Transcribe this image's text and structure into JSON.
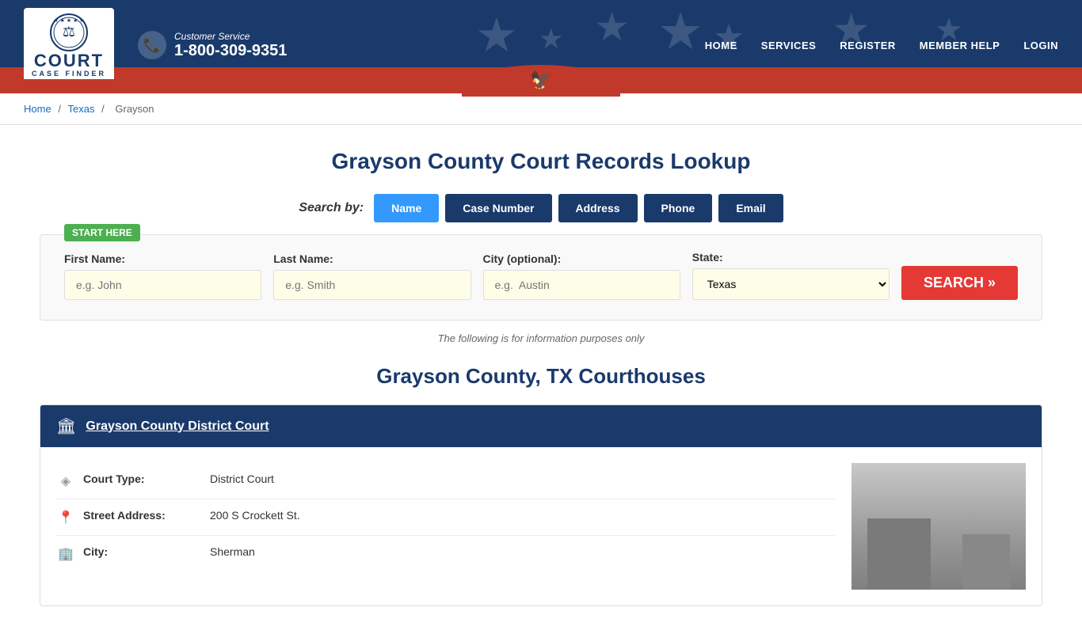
{
  "header": {
    "logo": {
      "main_text": "COURT",
      "sub_text": "CASE FINDER",
      "emblem_symbol": "⚖"
    },
    "phone": {
      "label": "Customer Service",
      "number": "1-800-309-9351"
    },
    "nav": [
      {
        "label": "HOME",
        "id": "nav-home"
      },
      {
        "label": "SERVICES",
        "id": "nav-services"
      },
      {
        "label": "REGISTER",
        "id": "nav-register"
      },
      {
        "label": "MEMBER HELP",
        "id": "nav-member-help"
      },
      {
        "label": "LOGIN",
        "id": "nav-login"
      }
    ]
  },
  "breadcrumb": {
    "home": "Home",
    "state": "Texas",
    "county": "Grayson"
  },
  "main": {
    "page_title": "Grayson County Court Records Lookup",
    "search_by_label": "Search by:",
    "tabs": [
      {
        "label": "Name",
        "active": true
      },
      {
        "label": "Case Number",
        "active": false
      },
      {
        "label": "Address",
        "active": false
      },
      {
        "label": "Phone",
        "active": false
      },
      {
        "label": "Email",
        "active": false
      }
    ],
    "start_here_badge": "START HERE",
    "form": {
      "first_name_label": "First Name:",
      "first_name_placeholder": "e.g. John",
      "last_name_label": "Last Name:",
      "last_name_placeholder": "e.g. Smith",
      "city_label": "City (optional):",
      "city_placeholder": "e.g.  Austin",
      "state_label": "State:",
      "state_value": "Texas",
      "search_button": "SEARCH »"
    },
    "info_note": "The following is for information purposes only",
    "courthouses_title": "Grayson County, TX Courthouses",
    "courts": [
      {
        "name": "Grayson County District Court",
        "header_icon": "🏛",
        "details": [
          {
            "icon": "⬧",
            "label": "Court Type:",
            "value": "District Court"
          },
          {
            "icon": "📍",
            "label": "Street Address:",
            "value": "200 S Crockett St."
          },
          {
            "icon": "🏢",
            "label": "City:",
            "value": "Sherman"
          }
        ]
      }
    ]
  }
}
